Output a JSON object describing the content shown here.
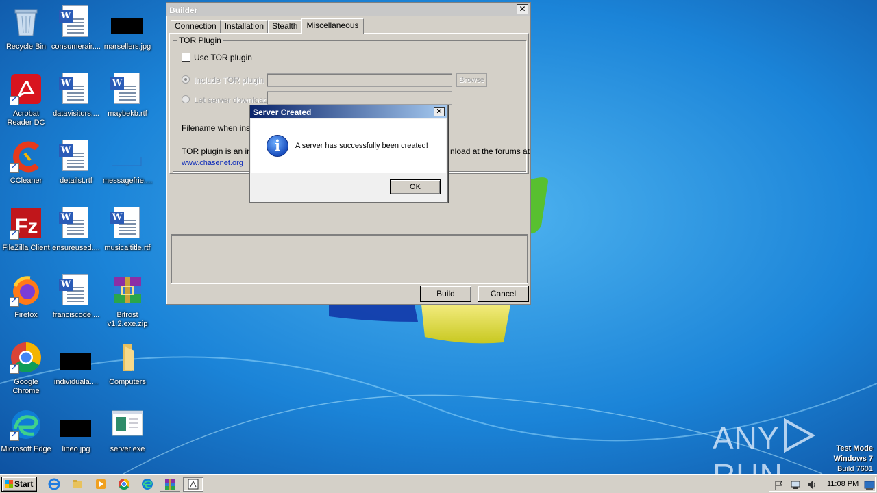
{
  "desktop": {
    "icons": [
      {
        "label": "Recycle Bin",
        "icon": "recycle-bin-icon"
      },
      {
        "label": "consumerair....",
        "icon": "word-document-icon"
      },
      {
        "label": "marsellers.jpg",
        "icon": "image-file-icon"
      },
      {
        "label": "Acrobat Reader DC",
        "icon": "acrobat-icon"
      },
      {
        "label": "datavisitors....",
        "icon": "word-document-icon"
      },
      {
        "label": "maybekb.rtf",
        "icon": "word-document-icon"
      },
      {
        "label": "CCleaner",
        "icon": "ccleaner-icon"
      },
      {
        "label": "detailst.rtf",
        "icon": "word-document-icon"
      },
      {
        "label": "messagefrie....",
        "icon": "image-file-icon"
      },
      {
        "label": "FileZilla Client",
        "icon": "filezilla-icon"
      },
      {
        "label": "ensureused....",
        "icon": "word-document-icon"
      },
      {
        "label": "musicaltitle.rtf",
        "icon": "word-document-icon"
      },
      {
        "label": "Firefox",
        "icon": "firefox-icon"
      },
      {
        "label": "franciscode....",
        "icon": "word-document-icon"
      },
      {
        "label": "Bifrost v1.2.exe.zip",
        "icon": "winrar-archive-icon"
      },
      {
        "label": "Google Chrome",
        "icon": "chrome-icon"
      },
      {
        "label": "individuala....",
        "icon": "image-file-icon"
      },
      {
        "label": "Computers",
        "icon": "folder-icon"
      },
      {
        "label": "Microsoft Edge",
        "icon": "edge-icon"
      },
      {
        "label": "lineo.jpg",
        "icon": "image-file-icon"
      },
      {
        "label": "server.exe",
        "icon": "exe-file-icon"
      }
    ]
  },
  "builder": {
    "title": "Builder",
    "close_glyph": "✕",
    "tabs": [
      "Connection",
      "Installation",
      "Stealth",
      "Miscellaneous"
    ],
    "active_tab": "Miscellaneous",
    "group_title": "TOR Plugin",
    "use_tor_label": "Use TOR plugin",
    "include_tor_label": "Include TOR plugin",
    "browse_label": "Browse",
    "let_server_label": "Let server download",
    "filename_label": "Filename when installe",
    "info_text_left": "TOR plugin is an indep",
    "info_text_right": "nload at the forums at",
    "link_text": "www.chasenet.org",
    "build_label": "Build",
    "cancel_label": "Cancel"
  },
  "dialog": {
    "title": "Server Created",
    "close_glyph": "✕",
    "icon": "info-icon",
    "message": "A server has successfully been created!",
    "ok_label": "OK"
  },
  "watermark": {
    "brand_left": "ANY",
    "brand_right": "RUN",
    "test_mode": "Test Mode",
    "os": "Windows 7",
    "build": "Build 7601"
  },
  "taskbar": {
    "start_label": "Start",
    "clock": "11:08 PM",
    "pinned": [
      "internet-explorer-icon",
      "explorer-icon",
      "media-player-icon",
      "chrome-icon",
      "edge-icon",
      "winrar-icon",
      "builder-app-icon"
    ]
  },
  "colors": {
    "dialog_title": "#0a246a",
    "link": "#0a28b8",
    "desktop": "#1d7fd0"
  }
}
